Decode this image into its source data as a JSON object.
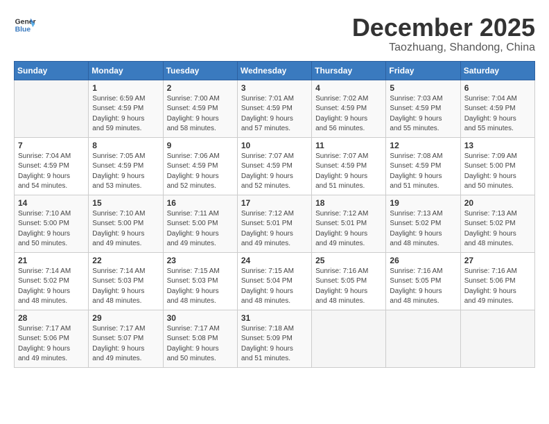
{
  "logo": {
    "line1": "General",
    "line2": "Blue"
  },
  "title": "December 2025",
  "location": "Taozhuang, Shandong, China",
  "weekdays": [
    "Sunday",
    "Monday",
    "Tuesday",
    "Wednesday",
    "Thursday",
    "Friday",
    "Saturday"
  ],
  "weeks": [
    [
      {
        "day": "",
        "info": ""
      },
      {
        "day": "1",
        "info": "Sunrise: 6:59 AM\nSunset: 4:59 PM\nDaylight: 9 hours\nand 59 minutes."
      },
      {
        "day": "2",
        "info": "Sunrise: 7:00 AM\nSunset: 4:59 PM\nDaylight: 9 hours\nand 58 minutes."
      },
      {
        "day": "3",
        "info": "Sunrise: 7:01 AM\nSunset: 4:59 PM\nDaylight: 9 hours\nand 57 minutes."
      },
      {
        "day": "4",
        "info": "Sunrise: 7:02 AM\nSunset: 4:59 PM\nDaylight: 9 hours\nand 56 minutes."
      },
      {
        "day": "5",
        "info": "Sunrise: 7:03 AM\nSunset: 4:59 PM\nDaylight: 9 hours\nand 55 minutes."
      },
      {
        "day": "6",
        "info": "Sunrise: 7:04 AM\nSunset: 4:59 PM\nDaylight: 9 hours\nand 55 minutes."
      }
    ],
    [
      {
        "day": "7",
        "info": "Sunrise: 7:04 AM\nSunset: 4:59 PM\nDaylight: 9 hours\nand 54 minutes."
      },
      {
        "day": "8",
        "info": "Sunrise: 7:05 AM\nSunset: 4:59 PM\nDaylight: 9 hours\nand 53 minutes."
      },
      {
        "day": "9",
        "info": "Sunrise: 7:06 AM\nSunset: 4:59 PM\nDaylight: 9 hours\nand 52 minutes."
      },
      {
        "day": "10",
        "info": "Sunrise: 7:07 AM\nSunset: 4:59 PM\nDaylight: 9 hours\nand 52 minutes."
      },
      {
        "day": "11",
        "info": "Sunrise: 7:07 AM\nSunset: 4:59 PM\nDaylight: 9 hours\nand 51 minutes."
      },
      {
        "day": "12",
        "info": "Sunrise: 7:08 AM\nSunset: 4:59 PM\nDaylight: 9 hours\nand 51 minutes."
      },
      {
        "day": "13",
        "info": "Sunrise: 7:09 AM\nSunset: 5:00 PM\nDaylight: 9 hours\nand 50 minutes."
      }
    ],
    [
      {
        "day": "14",
        "info": "Sunrise: 7:10 AM\nSunset: 5:00 PM\nDaylight: 9 hours\nand 50 minutes."
      },
      {
        "day": "15",
        "info": "Sunrise: 7:10 AM\nSunset: 5:00 PM\nDaylight: 9 hours\nand 49 minutes."
      },
      {
        "day": "16",
        "info": "Sunrise: 7:11 AM\nSunset: 5:00 PM\nDaylight: 9 hours\nand 49 minutes."
      },
      {
        "day": "17",
        "info": "Sunrise: 7:12 AM\nSunset: 5:01 PM\nDaylight: 9 hours\nand 49 minutes."
      },
      {
        "day": "18",
        "info": "Sunrise: 7:12 AM\nSunset: 5:01 PM\nDaylight: 9 hours\nand 49 minutes."
      },
      {
        "day": "19",
        "info": "Sunrise: 7:13 AM\nSunset: 5:02 PM\nDaylight: 9 hours\nand 48 minutes."
      },
      {
        "day": "20",
        "info": "Sunrise: 7:13 AM\nSunset: 5:02 PM\nDaylight: 9 hours\nand 48 minutes."
      }
    ],
    [
      {
        "day": "21",
        "info": "Sunrise: 7:14 AM\nSunset: 5:02 PM\nDaylight: 9 hours\nand 48 minutes."
      },
      {
        "day": "22",
        "info": "Sunrise: 7:14 AM\nSunset: 5:03 PM\nDaylight: 9 hours\nand 48 minutes."
      },
      {
        "day": "23",
        "info": "Sunrise: 7:15 AM\nSunset: 5:03 PM\nDaylight: 9 hours\nand 48 minutes."
      },
      {
        "day": "24",
        "info": "Sunrise: 7:15 AM\nSunset: 5:04 PM\nDaylight: 9 hours\nand 48 minutes."
      },
      {
        "day": "25",
        "info": "Sunrise: 7:16 AM\nSunset: 5:05 PM\nDaylight: 9 hours\nand 48 minutes."
      },
      {
        "day": "26",
        "info": "Sunrise: 7:16 AM\nSunset: 5:05 PM\nDaylight: 9 hours\nand 48 minutes."
      },
      {
        "day": "27",
        "info": "Sunrise: 7:16 AM\nSunset: 5:06 PM\nDaylight: 9 hours\nand 49 minutes."
      }
    ],
    [
      {
        "day": "28",
        "info": "Sunrise: 7:17 AM\nSunset: 5:06 PM\nDaylight: 9 hours\nand 49 minutes."
      },
      {
        "day": "29",
        "info": "Sunrise: 7:17 AM\nSunset: 5:07 PM\nDaylight: 9 hours\nand 49 minutes."
      },
      {
        "day": "30",
        "info": "Sunrise: 7:17 AM\nSunset: 5:08 PM\nDaylight: 9 hours\nand 50 minutes."
      },
      {
        "day": "31",
        "info": "Sunrise: 7:18 AM\nSunset: 5:09 PM\nDaylight: 9 hours\nand 51 minutes."
      },
      {
        "day": "",
        "info": ""
      },
      {
        "day": "",
        "info": ""
      },
      {
        "day": "",
        "info": ""
      }
    ]
  ]
}
